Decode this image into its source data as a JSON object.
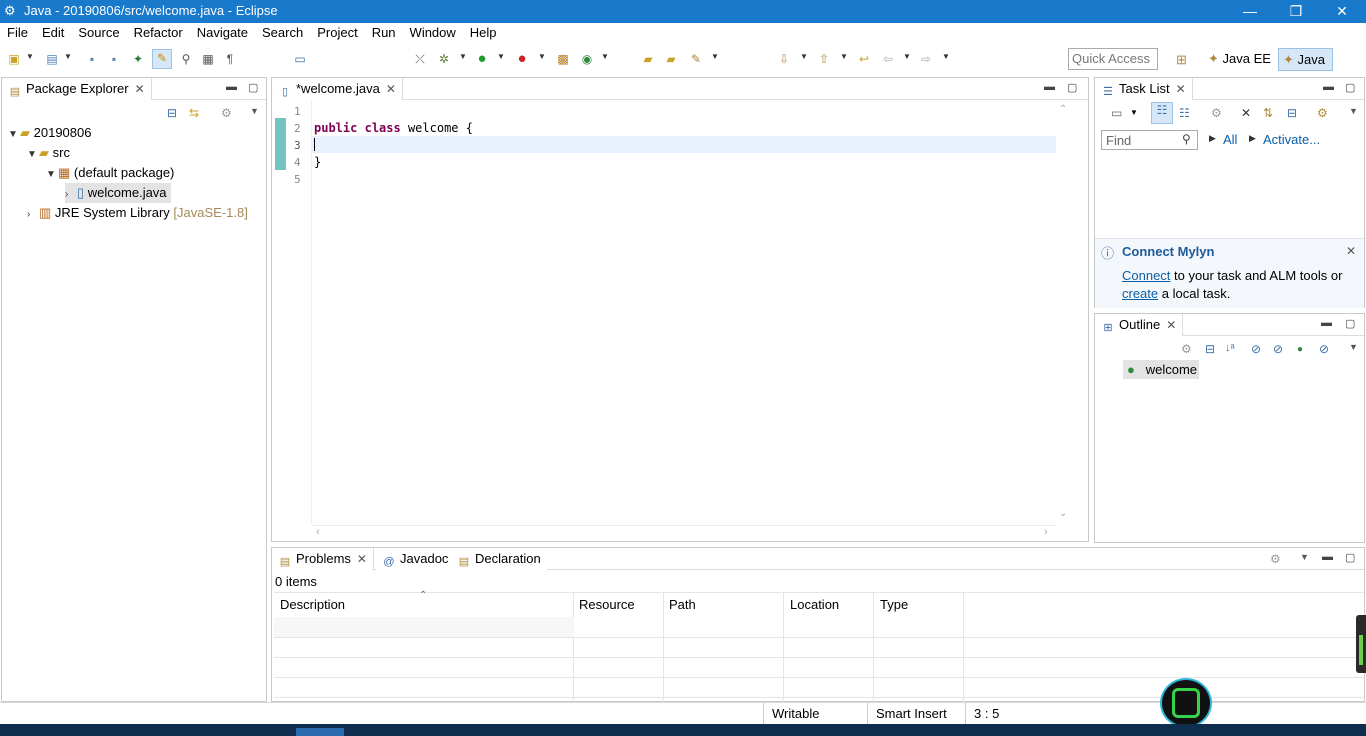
{
  "window": {
    "title": "Java - 20190806/src/welcome.java - Eclipse",
    "controls": {
      "minimize": "—",
      "maximize": "❐",
      "close": "✕"
    }
  },
  "menu": [
    "File",
    "Edit",
    "Source",
    "Refactor",
    "Navigate",
    "Search",
    "Project",
    "Run",
    "Window",
    "Help"
  ],
  "toolbar": {
    "quick_access_placeholder": "Quick Access",
    "perspectives": [
      "Java EE",
      "Java"
    ]
  },
  "package_explorer": {
    "tab_label": "Package Explorer",
    "tree": {
      "project": "20190806",
      "src": "src",
      "package": "(default package)",
      "file": "welcome.java",
      "library": "JRE System Library",
      "library_version": "[JavaSE-1.8]"
    }
  },
  "editor": {
    "tab_label": "*welcome.java",
    "line_numbers": [
      "1",
      "2",
      "3",
      "4",
      "5"
    ],
    "lines": {
      "l2_kw1": "public",
      "l2_kw2": "class",
      "l2_rest": " welcome {",
      "l4": "}"
    }
  },
  "task_list": {
    "tab_label": "Task List",
    "find_placeholder": "Find",
    "all_label": "All",
    "activate_label": "Activate..."
  },
  "mylyn": {
    "title": "Connect Mylyn",
    "connect_link": "Connect",
    "text1": " to your task and ALM tools or",
    "create_link": "create",
    "text2": " a local task."
  },
  "outline": {
    "tab_label": "Outline",
    "item": "welcome"
  },
  "bottom": {
    "tabs": [
      "Problems",
      "Javadoc",
      "Declaration"
    ],
    "items_count": "0 items",
    "columns": [
      "Description",
      "Resource",
      "Path",
      "Location",
      "Type"
    ]
  },
  "status": {
    "writable": "Writable",
    "insert_mode": "Smart Insert",
    "position": "3 : 5"
  },
  "colors": {
    "titlebar": "#1979ca",
    "keyword": "#7f0055",
    "link": "#0a5fa8"
  }
}
